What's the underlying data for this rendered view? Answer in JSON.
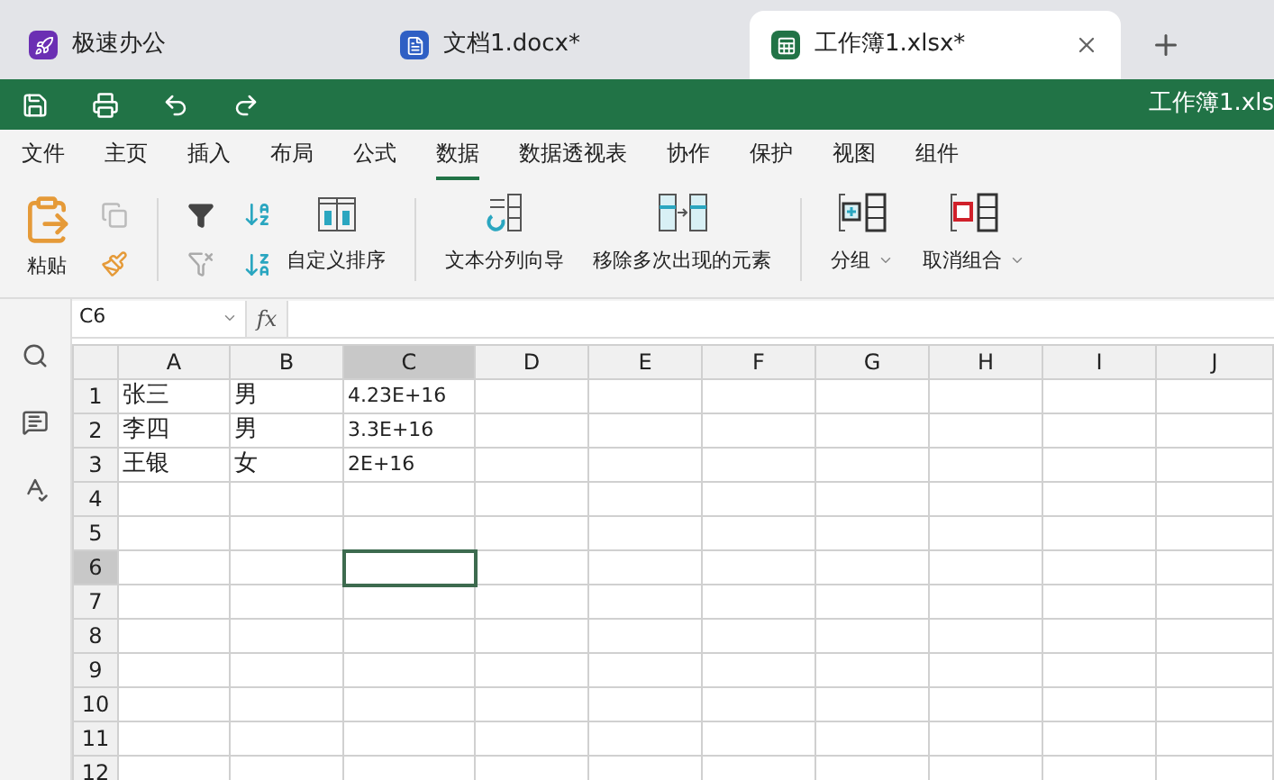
{
  "tabs": [
    {
      "label": "极速办公",
      "kind": "app",
      "selected": false
    },
    {
      "label": "文档1.docx*",
      "kind": "writer",
      "selected": false
    },
    {
      "label": "工作簿1.xlsx*",
      "kind": "sheet",
      "selected": true
    }
  ],
  "title_bar": {
    "title": "工作簿1.xls"
  },
  "menu": [
    {
      "label": "文件",
      "selected": false
    },
    {
      "label": "主页",
      "selected": false
    },
    {
      "label": "插入",
      "selected": false
    },
    {
      "label": "布局",
      "selected": false
    },
    {
      "label": "公式",
      "selected": false
    },
    {
      "label": "数据",
      "selected": true
    },
    {
      "label": "数据透视表",
      "selected": false
    },
    {
      "label": "协作",
      "selected": false
    },
    {
      "label": "保护",
      "selected": false
    },
    {
      "label": "视图",
      "selected": false
    },
    {
      "label": "组件",
      "selected": false
    }
  ],
  "ribbon": {
    "paste": "粘贴",
    "custom_sort": "自定义排序",
    "text_to_columns": "文本分列向导",
    "remove_duplicates": "移除多次出现的元素",
    "group": "分组",
    "ungroup": "取消组合"
  },
  "formula_bar": {
    "name_box": "C6",
    "fx": "fx"
  },
  "sheet": {
    "columns": [
      {
        "label": "A",
        "selected": false
      },
      {
        "label": "B",
        "selected": false
      },
      {
        "label": "C",
        "selected": true
      },
      {
        "label": "D",
        "selected": false
      },
      {
        "label": "E",
        "selected": false
      },
      {
        "label": "F",
        "selected": false
      },
      {
        "label": "G",
        "selected": false
      },
      {
        "label": "H",
        "selected": false
      },
      {
        "label": "I",
        "selected": false
      },
      {
        "label": "J",
        "selected": false
      }
    ],
    "rows": [
      {
        "label": "1",
        "selected": false,
        "cells": [
          "张三",
          "男",
          "4.23E+16"
        ]
      },
      {
        "label": "2",
        "selected": false,
        "cells": [
          "李四",
          "男",
          "3.3E+16"
        ]
      },
      {
        "label": "3",
        "selected": false,
        "cells": [
          "王银",
          "女",
          "2E+16"
        ]
      },
      {
        "label": "4",
        "selected": false,
        "cells": []
      },
      {
        "label": "5",
        "selected": false,
        "cells": []
      },
      {
        "label": "6",
        "selected": true,
        "cells": []
      },
      {
        "label": "7",
        "selected": false,
        "cells": []
      },
      {
        "label": "8",
        "selected": false,
        "cells": []
      },
      {
        "label": "9",
        "selected": false,
        "cells": []
      },
      {
        "label": "10",
        "selected": false,
        "cells": []
      },
      {
        "label": "11",
        "selected": false,
        "cells": []
      },
      {
        "label": "12",
        "selected": false,
        "cells": []
      }
    ]
  }
}
